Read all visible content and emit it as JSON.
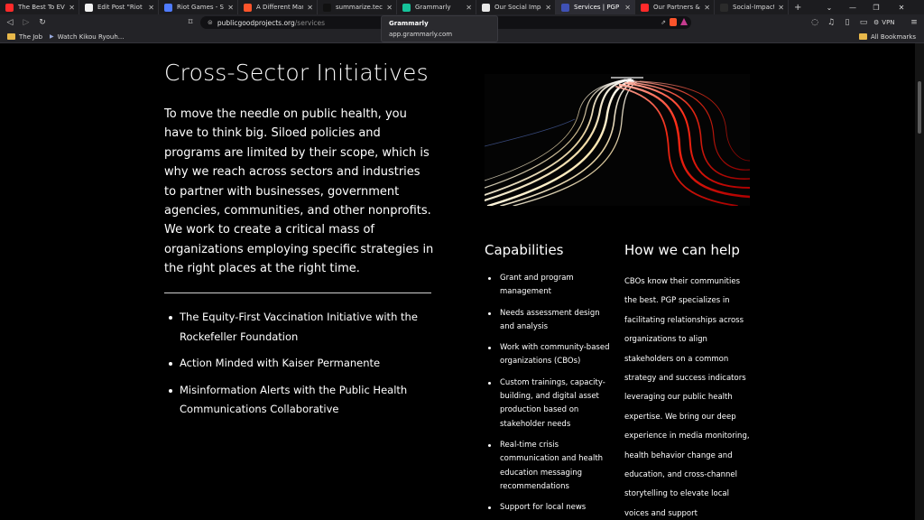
{
  "browser": {
    "tabs": [
      {
        "title": "The Best To EVER Do",
        "color": "#ff2a2a",
        "active": false
      },
      {
        "title": "Edit Post \"Riot Games La",
        "color": "#f2f2f2",
        "active": false
      },
      {
        "title": "Riot Games - Search Im",
        "color": "#4f7bff",
        "active": false
      },
      {
        "title": "A Different Man - Brave",
        "color": "#fb542b",
        "active": false
      },
      {
        "title": "summarize.tech: AI-pow",
        "color": "#111111",
        "active": false
      },
      {
        "title": "Grammarly",
        "color": "#15c39a",
        "active": false
      },
      {
        "title": "Our Social Impact Partn",
        "color": "#e8e8e8",
        "active": false
      },
      {
        "title": "Services | PGP",
        "color": "#3f51b5",
        "active": true
      },
      {
        "title": "Our Partners & Sponsor",
        "color": "#ff2a2a",
        "active": false
      },
      {
        "title": "Social-Impact Investme",
        "color": "#2b2b2b",
        "active": false
      }
    ],
    "url_host": "publicgoodprojects.org",
    "url_path": "/services",
    "vpn_label": "VPN",
    "bookmarks": [
      "The Job",
      "Watch Kikou Ryouh..."
    ],
    "all_bookmarks": "All Bookmarks",
    "tooltip": {
      "title": "Grammarly",
      "subtitle": "app.grammarly.com"
    }
  },
  "page": {
    "heading": "Cross-Sector Initiatives",
    "lead": "To move the needle on public health, you have to think big. Siloed policies and programs are limited by their scope, which is why we reach across sectors and industries to partner with businesses, government agencies, communities, and other nonprofits. We work to create a critical mass of organizations employing specific strategies in the right places at the right time.",
    "initiatives": [
      "The Equity-First Vaccination Initiative with the Rockefeller Foundation",
      "Action Minded with Kaiser Permanente",
      "Misinformation Alerts with the Public Health Communications Collaborative"
    ],
    "capabilities_heading": "Capabilities",
    "capabilities": [
      "Grant and program management",
      "Needs assessment design and analysis",
      "Work with community-based organizations (CBOs)",
      "Custom trainings, capacity-building, and digital asset production based on stakeholder needs",
      "Real-time crisis communication and health education messaging recommendations",
      "Support for local news"
    ],
    "help_heading": "How we can help",
    "help_text": "CBOs know their communities the best. PGP specializes in facilitating relationships across organizations to align stakeholders on a common strategy and success indicators leveraging our public health expertise. We bring our deep experience in media monitoring, health behavior change and education, and cross-channel storytelling to elevate local voices and support"
  }
}
